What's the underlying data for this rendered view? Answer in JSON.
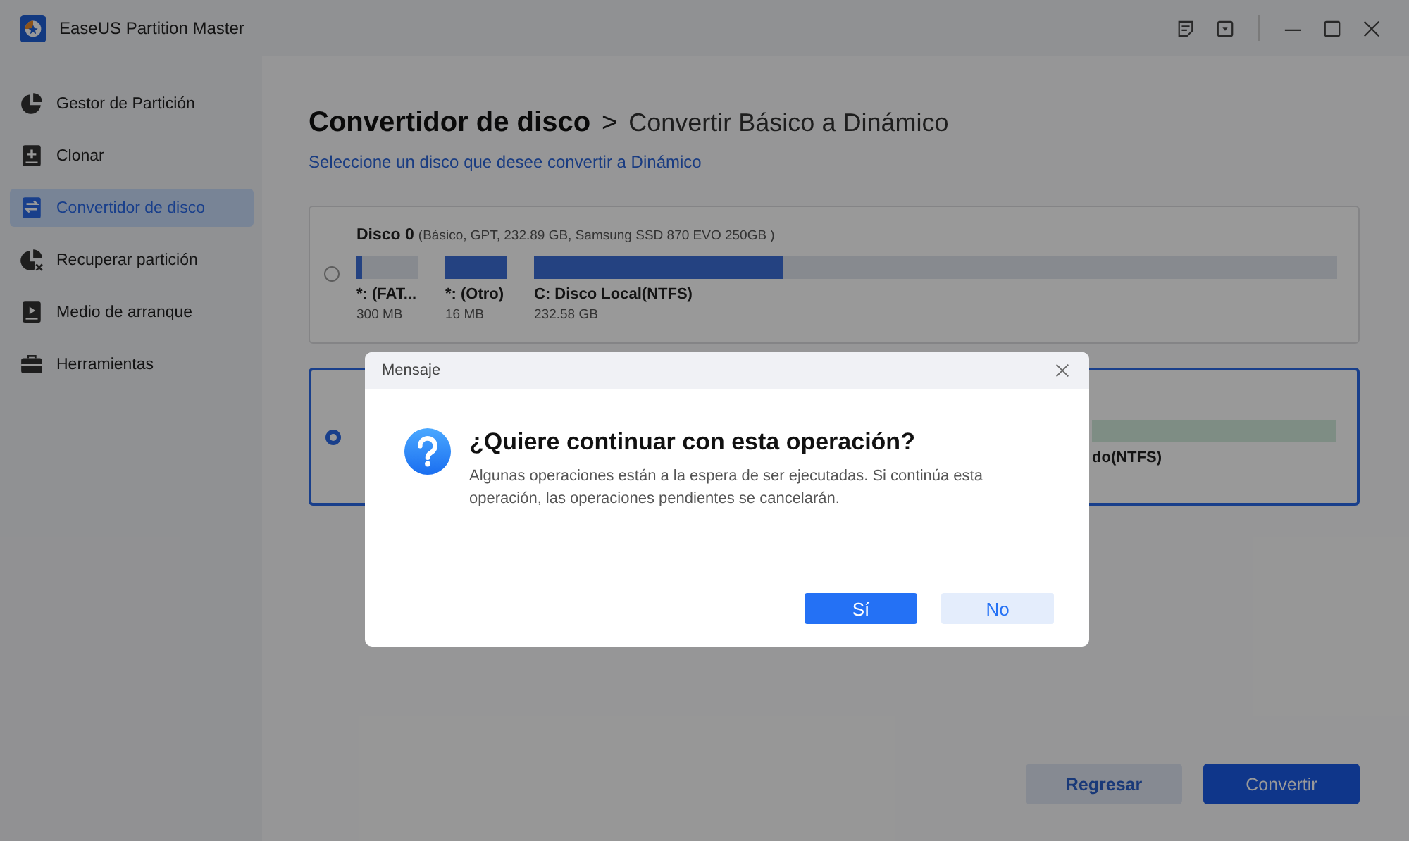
{
  "window": {
    "title": "EaseUS Partition Master"
  },
  "sidebar": {
    "items": [
      {
        "label": "Gestor de Partición",
        "selected": false
      },
      {
        "label": "Clonar",
        "selected": false
      },
      {
        "label": "Convertidor de disco",
        "selected": true
      },
      {
        "label": "Recuperar partición",
        "selected": false
      },
      {
        "label": "Medio de arranque",
        "selected": false
      },
      {
        "label": "Herramientas",
        "selected": false
      }
    ]
  },
  "page": {
    "title": "Convertidor de disco",
    "separator": ">",
    "subtitle": "Convertir Básico a Dinámico",
    "hint": "Seleccione un disco que desee convertir a Dinámico"
  },
  "disks": [
    {
      "name": "Disco 0",
      "details": "(Básico, GPT, 232.89 GB, Samsung SSD 870 EVO 250GB )",
      "selected": false,
      "partitions": [
        {
          "label": "*: (FAT...",
          "size": "300 MB",
          "level": 0.1
        },
        {
          "label": "*: (Otro)",
          "size": "16 MB",
          "level": 1
        },
        {
          "label": "C: Disco Local(NTFS)",
          "size": "232.58 GB",
          "level": 0.31
        }
      ]
    },
    {
      "selected": true,
      "partitions": [
        {
          "label": "do(NTFS)"
        }
      ]
    }
  ],
  "footer": {
    "buttons": [
      {
        "label": "Regresar",
        "kind": "secondary"
      },
      {
        "label": "Convertir",
        "kind": "primary"
      }
    ]
  },
  "dialog": {
    "title": "Mensaje",
    "heading": "¿Quiere continuar con esta operación?",
    "body": "Algunas operaciones están a la espera de ser ejecutadas. Si continúa esta operación, las operaciones pendientes se cancelarán.",
    "buttons": [
      {
        "label": "Sí",
        "kind": "primary"
      },
      {
        "label": "No",
        "kind": "secondary"
      }
    ]
  }
}
